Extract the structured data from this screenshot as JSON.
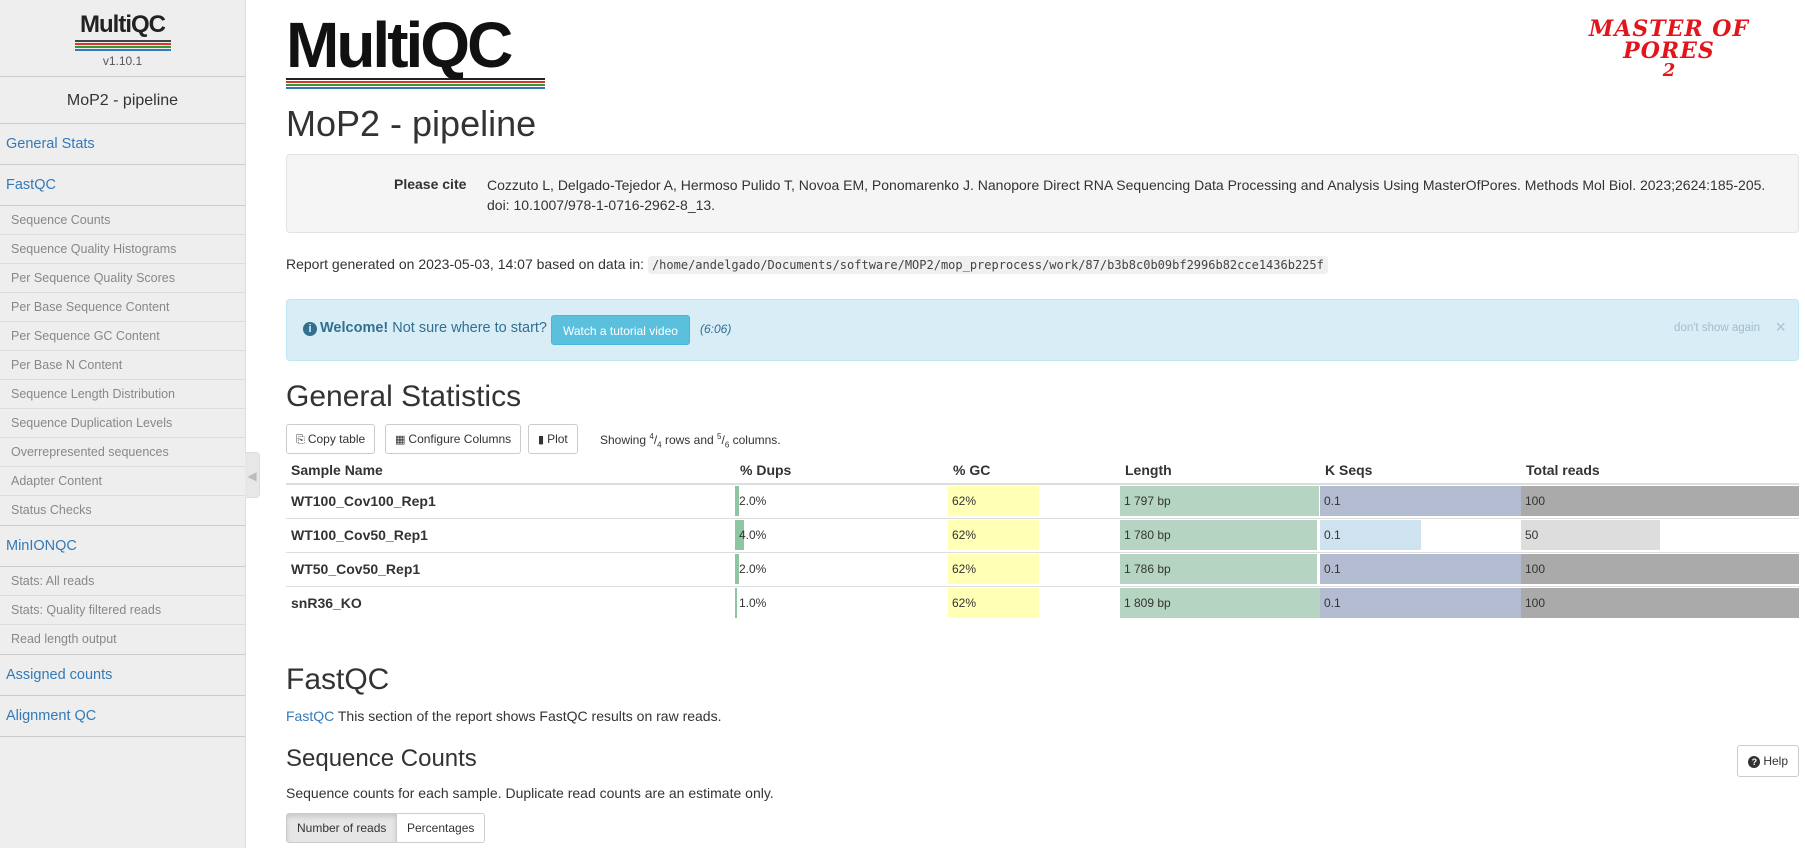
{
  "sidebar": {
    "logo_text": "MultiQC",
    "version": "v1.10.1",
    "title": "MoP2 - pipeline",
    "sections": [
      {
        "label": "General Stats",
        "items": []
      },
      {
        "label": "FastQC",
        "items": [
          "Sequence Counts",
          "Sequence Quality Histograms",
          "Per Sequence Quality Scores",
          "Per Base Sequence Content",
          "Per Sequence GC Content",
          "Per Base N Content",
          "Sequence Length Distribution",
          "Sequence Duplication Levels",
          "Overrepresented sequences",
          "Adapter Content",
          "Status Checks"
        ]
      },
      {
        "label": "MinIONQC",
        "items": [
          "Stats: All reads",
          "Stats: Quality filtered reads",
          "Read length output"
        ]
      },
      {
        "label": "Assigned counts",
        "items": []
      },
      {
        "label": "Alignment QC",
        "items": []
      }
    ]
  },
  "header": {
    "logo_text": "MultiQC",
    "mop_logo_line1": "MASTER OF PORES",
    "mop_logo_line2": "2",
    "report_title": "MoP2 - pipeline"
  },
  "cite": {
    "label": "Please cite",
    "text": "Cozzuto L, Delgado-Tejedor A, Hermoso Pulido T, Novoa EM, Ponomarenko J. Nanopore Direct RNA Sequencing Data Processing and Analysis Using MasterOfPores. Methods Mol Biol. 2023;2624:185-205. doi: 10.1007/978-1-0716-2962-8_13."
  },
  "generated": {
    "prefix": "Report generated on 2023-05-03, 14:07 based on data in:",
    "path": "/home/andelgado/Documents/software/MOP2/mop_preprocess/work/87/b3b8c0b09bf2996b82cce1436b225f"
  },
  "welcome": {
    "bold": "Welcome!",
    "text": "Not sure where to start?",
    "button": "Watch a tutorial video",
    "duration": "(6:06)",
    "dismiss": "don't show again",
    "close": "×"
  },
  "general_stats": {
    "title": "General Statistics",
    "buttons": {
      "copy": "Copy table",
      "configure": "Configure Columns",
      "plot": "Plot"
    },
    "showing_text": {
      "pre": "Showing",
      "rows_num": "4",
      "rows_den": "4",
      "mid": "rows and",
      "cols_num": "5",
      "cols_den": "6",
      "post": "columns."
    },
    "columns": [
      "Sample Name",
      "% Dups",
      "% GC",
      "Length",
      "K Seqs",
      "Total reads"
    ],
    "colors": {
      "dups": "#8dc6a0",
      "gc": "#ffffb6",
      "length": "#b5d5c2",
      "kseqs_full": "#b3bcd0",
      "kseqs_half": "#cfe2ef",
      "total_full": "#aaaaaa",
      "total_half": "#dddddd"
    },
    "rows": [
      {
        "name": "WT100_Cov100_Rep1",
        "dups": "2.0%",
        "dups_frac": 0.02,
        "gc": "62%",
        "gc_frac": 0.62,
        "length": "1 797 bp",
        "length_frac": 0.993,
        "kseqs": "0.1",
        "kseqs_frac": 1.0,
        "total": "100",
        "total_frac": 1.0
      },
      {
        "name": "WT100_Cov50_Rep1",
        "dups": "4.0%",
        "dups_frac": 0.04,
        "gc": "62%",
        "gc_frac": 0.62,
        "length": "1 780 bp",
        "length_frac": 0.984,
        "kseqs": "0.1",
        "kseqs_frac": 0.5,
        "total": "50",
        "total_frac": 0.5
      },
      {
        "name": "WT50_Cov50_Rep1",
        "dups": "2.0%",
        "dups_frac": 0.02,
        "gc": "62%",
        "gc_frac": 0.62,
        "length": "1 786 bp",
        "length_frac": 0.987,
        "kseqs": "0.1",
        "kseqs_frac": 1.0,
        "total": "100",
        "total_frac": 1.0
      },
      {
        "name": "snR36_KO",
        "dups": "1.0%",
        "dups_frac": 0.01,
        "gc": "62%",
        "gc_frac": 0.62,
        "length": "1 809 bp",
        "length_frac": 1.0,
        "kseqs": "0.1",
        "kseqs_frac": 1.0,
        "total": "100",
        "total_frac": 1.0
      }
    ]
  },
  "fastqc": {
    "title": "FastQC",
    "link": "FastQC",
    "desc": "This section of the report shows FastQC results on raw reads."
  },
  "sequence_counts": {
    "title": "Sequence Counts",
    "help": "Help",
    "desc": "Sequence counts for each sample. Duplicate read counts are an estimate only.",
    "toggle_reads": "Number of reads",
    "toggle_pct": "Percentages"
  }
}
